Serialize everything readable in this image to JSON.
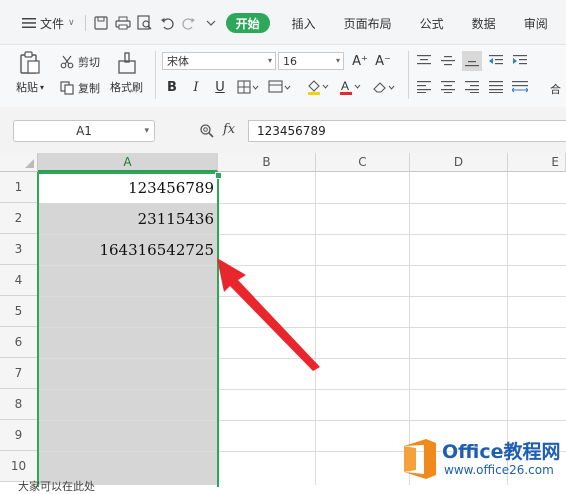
{
  "menu": {
    "file_label": "文件",
    "tabs": [
      {
        "label": "开始",
        "active": true
      },
      {
        "label": "插入"
      },
      {
        "label": "页面布局"
      },
      {
        "label": "公式"
      },
      {
        "label": "数据"
      },
      {
        "label": "审阅"
      }
    ]
  },
  "toolbar": {
    "paste_label": "粘贴",
    "cut_label": "剪切",
    "copy_label": "复制",
    "format_painter_label": "格式刷",
    "font_name": "宋体",
    "font_size": "16",
    "increase_font_label": "A⁺",
    "decrease_font_label": "A⁻",
    "bold_label": "B",
    "italic_label": "I",
    "underline_label": "U",
    "partial_right_label": "合"
  },
  "formula_bar": {
    "name_box": "A1",
    "fx_label": "fx",
    "value": "123456789"
  },
  "grid": {
    "columns": [
      "A",
      "B",
      "C",
      "D",
      "E"
    ],
    "rows": [
      "1",
      "2",
      "3",
      "4",
      "5",
      "6",
      "7",
      "8",
      "9",
      "10"
    ],
    "cells": [
      "123456789",
      "23115436",
      "164316542725"
    ]
  },
  "footer": {
    "partial_caption": "大家可以在此处"
  },
  "watermark": {
    "brand": "Office教程网",
    "url": "www.office26.com"
  },
  "colors": {
    "accent": "#2ea75b",
    "arrow": "#e8262c",
    "logo_orange": "#f08a1c"
  }
}
